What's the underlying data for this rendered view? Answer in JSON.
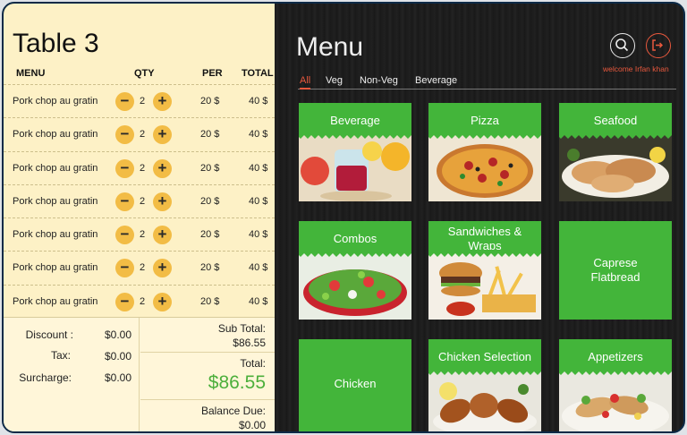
{
  "order": {
    "table_title": "Table 3",
    "columns": {
      "menu": "MENU",
      "qty": "QTY",
      "per": "PER",
      "total": "TOTAL"
    },
    "items": [
      {
        "name": "Pork chop au gratin",
        "minus": "−",
        "qty": "2",
        "plus": "+",
        "per": "20 $",
        "total": "40 $"
      },
      {
        "name": "Pork chop au gratin",
        "minus": "−",
        "qty": "2",
        "plus": "+",
        "per": "20 $",
        "total": "40 $"
      },
      {
        "name": "Pork chop au gratin",
        "minus": "−",
        "qty": "2",
        "plus": "+",
        "per": "20 $",
        "total": "40 $"
      },
      {
        "name": "Pork chop au gratin",
        "minus": "−",
        "qty": "2",
        "plus": "+",
        "per": "20 $",
        "total": "40 $"
      },
      {
        "name": "Pork chop au gratin",
        "minus": "−",
        "qty": "2",
        "plus": "+",
        "per": "20 $",
        "total": "40 $"
      },
      {
        "name": "Pork chop au gratin",
        "minus": "−",
        "qty": "2",
        "plus": "+",
        "per": "20 $",
        "total": "40 $"
      },
      {
        "name": "Pork chop au gratin",
        "minus": "−",
        "qty": "2",
        "plus": "+",
        "per": "20 $",
        "total": "40 $"
      }
    ],
    "summary": {
      "discount_label": "Discount :",
      "discount_value": "$0.00",
      "tax_label": "Tax:",
      "tax_value": "$0.00",
      "surcharge_label": "Surcharge:",
      "surcharge_value": "$0.00",
      "subtotal_label": "Sub Total:",
      "subtotal_value": "$86.55",
      "total_label": "Total:",
      "total_value": "$86.55",
      "balance_label": "Balance Due:",
      "balance_value": "$0.00"
    }
  },
  "menu": {
    "title": "Menu",
    "welcome": "welcome Irfan khan",
    "tabs": [
      "All",
      "Veg",
      "Non-Veg",
      "Beverage"
    ],
    "active_tab": "All",
    "categories": [
      {
        "label": "Beverage",
        "icon": "beverage-photo"
      },
      {
        "label": "Pizza",
        "icon": "pizza-photo"
      },
      {
        "label": "Seafood",
        "icon": "seafood-photo"
      },
      {
        "label": "Combos",
        "icon": "salad-photo"
      },
      {
        "label": "Sandwiches & Wraps",
        "icon": "burger-photo"
      },
      {
        "label": "Caprese Flatbread",
        "icon": ""
      },
      {
        "label": "Chicken",
        "icon": ""
      },
      {
        "label": "Chicken Selection",
        "icon": "chicken-photo"
      },
      {
        "label": "Appetizers",
        "icon": "appetizer-photo"
      }
    ]
  },
  "colors": {
    "accent_green": "#43b53a",
    "accent_orange": "#e8583d",
    "panel_cream": "#fdf1c6",
    "button_yellow": "#f2bc45"
  }
}
